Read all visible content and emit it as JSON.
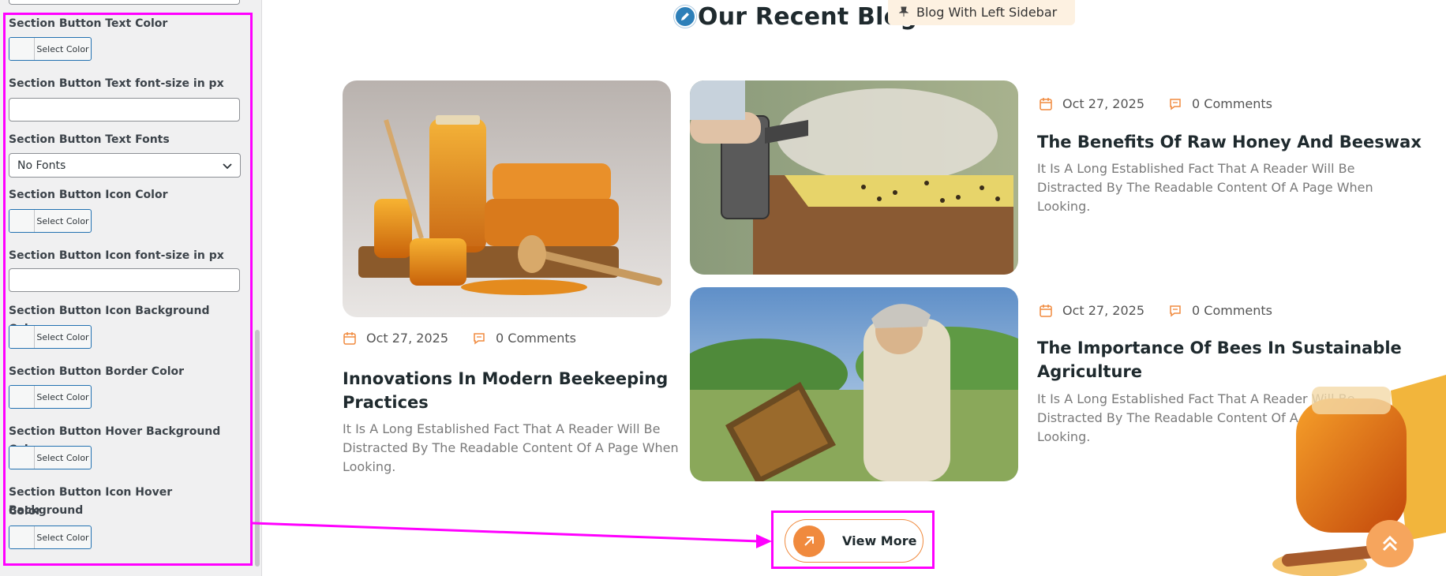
{
  "sidebar": {
    "controls": [
      {
        "label": "Section Button Text Color",
        "type": "color",
        "button": "Select Color"
      },
      {
        "label": "Section Button Text font-size in px",
        "type": "text",
        "value": ""
      },
      {
        "label": "Section Button Text Fonts",
        "type": "select",
        "value": "No Fonts"
      },
      {
        "label": "Section Button Icon Color",
        "type": "color",
        "button": "Select Color"
      },
      {
        "label": "Section Button Icon font-size in px",
        "type": "text",
        "value": ""
      },
      {
        "label": "Section Button Icon Background Color",
        "type": "color",
        "button": "Select Color"
      },
      {
        "label": "Section Button Border Color",
        "type": "color",
        "button": "Select Color"
      },
      {
        "label": "Section Button Hover Background Color",
        "type": "color",
        "button": "Select Color"
      },
      {
        "label_line1": "Section Button Icon Hover Background",
        "label_line2": "Color",
        "type": "color",
        "button": "Select Color"
      }
    ]
  },
  "preview": {
    "section_title": "Our Recent Blogs And News",
    "menu_tooltip": "Blog With Left Sidebar",
    "posts": [
      {
        "date": "Oct 27, 2025",
        "comments": "0 Comments",
        "title_line1": "Innovations In Modern Beekeeping",
        "title_line2": "Practices",
        "excerpt_line1": "It Is A Long Established Fact That A Reader Will Be",
        "excerpt_line2": "Distracted By The Readable Content Of A Page When",
        "excerpt_line3": "Looking."
      },
      {
        "date": "Oct 27, 2025",
        "comments": "0 Comments",
        "title_line1": "The Benefits Of Raw Honey And Beeswax",
        "excerpt_line1": "It Is A Long Established Fact That A Reader Will Be",
        "excerpt_line2": "Distracted By The Readable Content Of A Page When",
        "excerpt_line3": "Looking."
      },
      {
        "date": "Oct 27, 2025",
        "comments": "0 Comments",
        "title_line1": "The Importance Of Bees In Sustainable",
        "title_line2": "Agriculture",
        "excerpt_line1": "It Is A Long Established Fact That A Reader Will Be",
        "excerpt_line2": "Distracted By The Readable Content Of A Page When",
        "excerpt_line3": "Looking."
      }
    ],
    "view_more": "View More"
  },
  "colors": {
    "accent": "#f08a3e",
    "highlight": "#ff00ff",
    "title": "#1f2a2e"
  },
  "icons": [
    "pencil-icon",
    "pin-icon",
    "calendar-icon",
    "comment-icon",
    "arrow-up-right-icon",
    "double-chevron-up-icon",
    "chevron-down-icon"
  ]
}
